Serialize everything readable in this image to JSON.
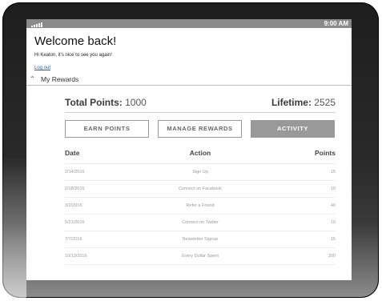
{
  "statusbar": {
    "time": "9:00 AM"
  },
  "header": {
    "welcome": "Welcome back!",
    "greeting": "Hi Keaton, it's nice to see you again!",
    "logout": "Log out"
  },
  "rewards": {
    "section_label": "My Rewards",
    "total_label": "Total Points:",
    "total_value": "1000",
    "lifetime_label": "Lifetime:",
    "lifetime_value": "2525"
  },
  "tabs": [
    {
      "label": "EARN POINTS",
      "active": false
    },
    {
      "label": "MANAGE REWARDS",
      "active": false
    },
    {
      "label": "ACTIVITY",
      "active": true
    }
  ],
  "table": {
    "columns": [
      "Date",
      "Action",
      "Points"
    ],
    "rows": [
      {
        "date": "2/14/2016",
        "action": "Sign Up",
        "points": "15"
      },
      {
        "date": "2/18/2016",
        "action": "Connect on Facebook",
        "points": "10"
      },
      {
        "date": "3/2/2016",
        "action": "Refer a Friend",
        "points": "40"
      },
      {
        "date": "5/21/2016",
        "action": "Connect on Twitter",
        "points": "10"
      },
      {
        "date": "7/7/2016",
        "action": "Newsletter Signup",
        "points": "15"
      },
      {
        "date": "10/13/2016",
        "action": "Every Dollar Spent",
        "points": "200"
      }
    ]
  }
}
